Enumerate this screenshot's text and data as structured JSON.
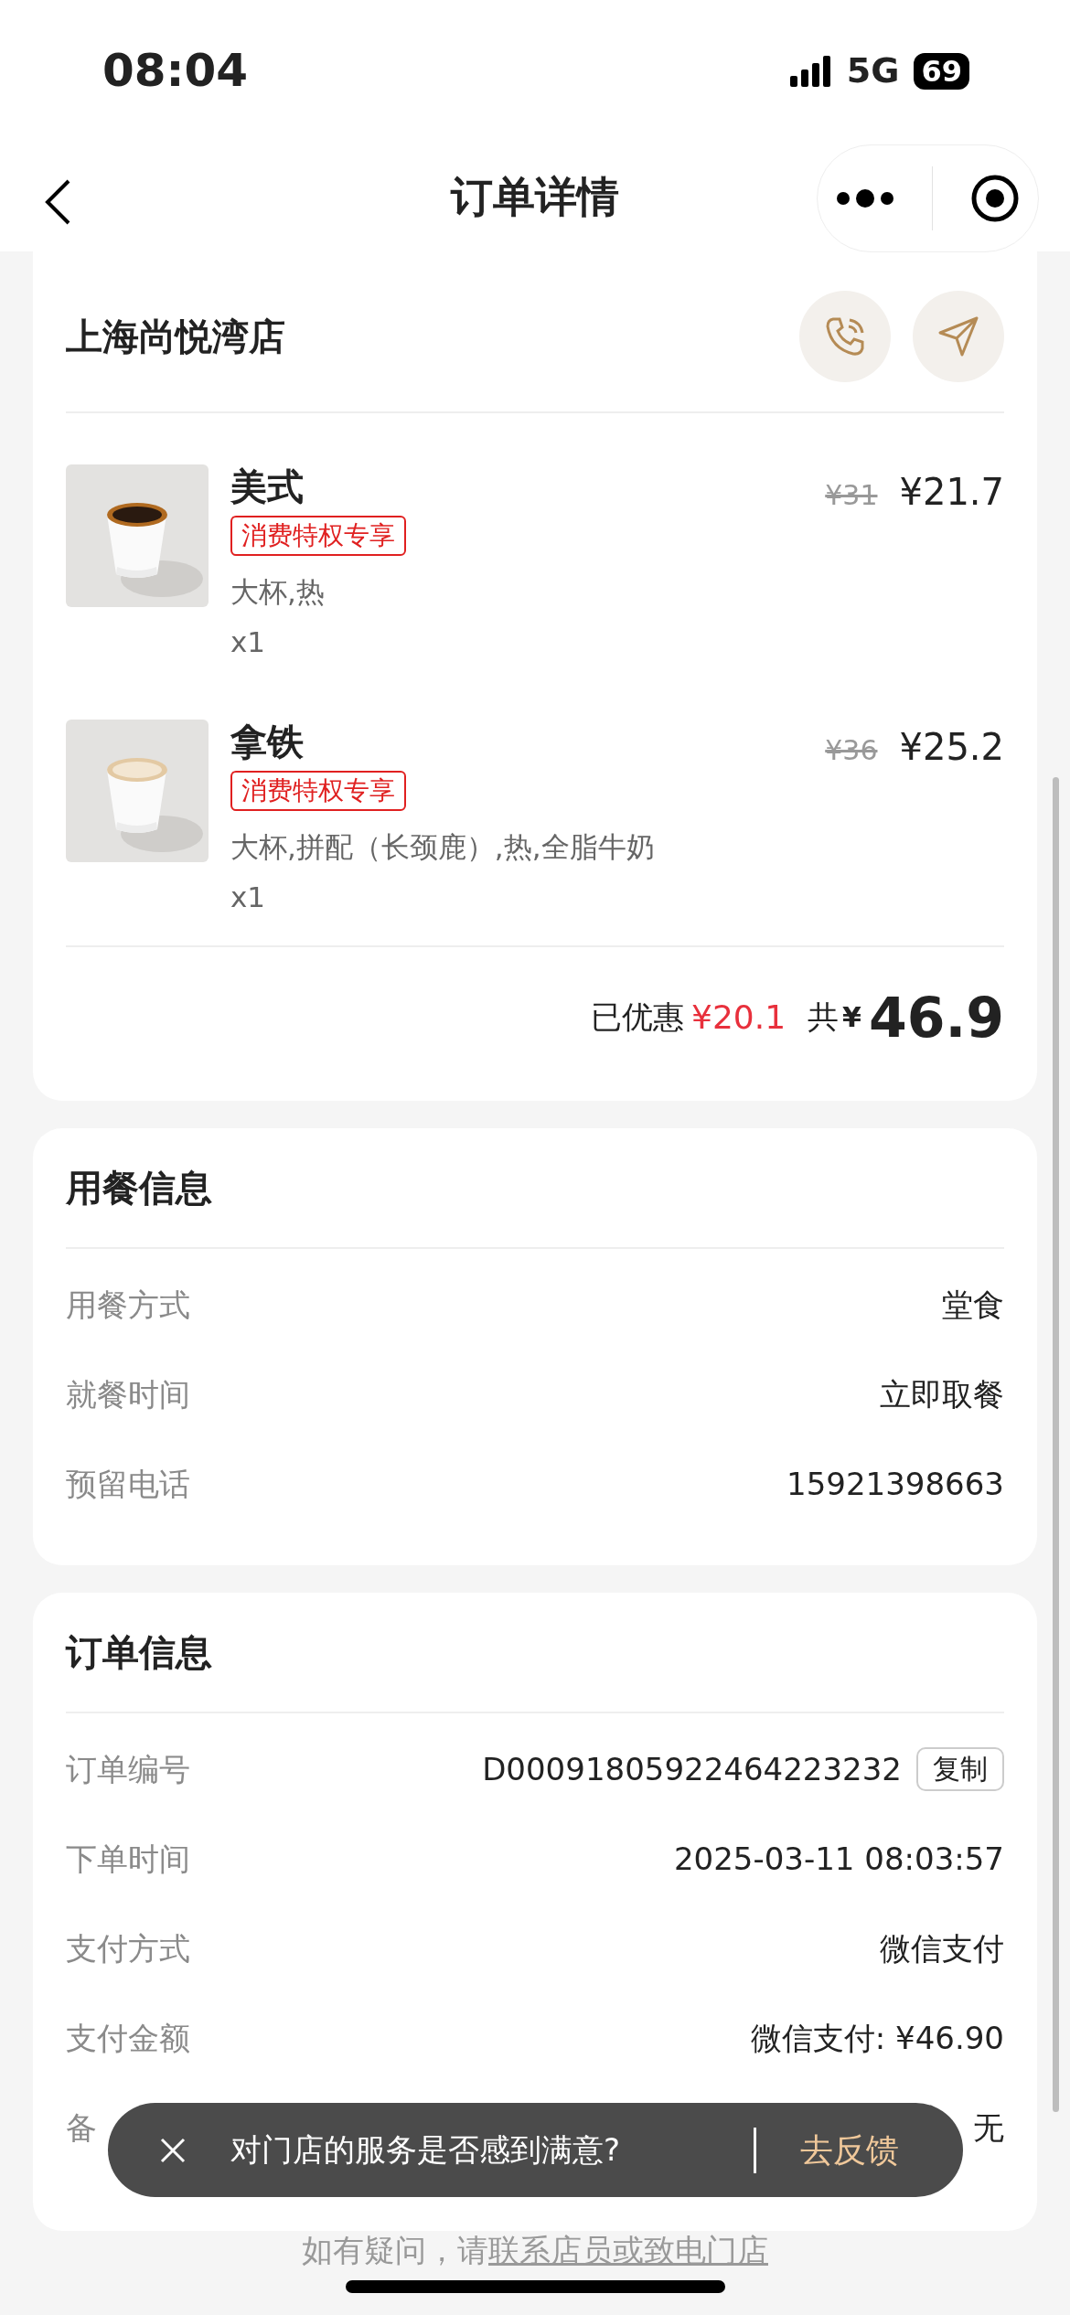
{
  "status_bar": {
    "time": "08:04",
    "network": "5G",
    "battery": "69"
  },
  "nav": {
    "title": "订单详情"
  },
  "store": {
    "name": "上海尚悦湾店"
  },
  "items": [
    {
      "name": "美式",
      "tag": "消费特权专享",
      "spec": "大杯,热",
      "qty": "x1",
      "original_price": "¥31",
      "price": "¥21.7",
      "kind": "black"
    },
    {
      "name": "拿铁",
      "tag": "消费特权专享",
      "spec": "大杯,拼配（长颈鹿）,热,全脂牛奶",
      "qty": "x1",
      "original_price": "¥36",
      "price": "¥25.2",
      "kind": "latte"
    }
  ],
  "summary": {
    "discount_label": "已优惠",
    "discount": "¥20.1",
    "total_label": "共",
    "currency": "¥",
    "total": "46.9"
  },
  "dining": {
    "title": "用餐信息",
    "rows": [
      {
        "label": "用餐方式",
        "value": "堂食"
      },
      {
        "label": "就餐时间",
        "value": "立即取餐"
      },
      {
        "label": "预留电话",
        "value": "15921398663"
      }
    ]
  },
  "order": {
    "title": "订单信息",
    "rows": [
      {
        "label": "订单编号",
        "value": "D00091805922464223232",
        "action": "复制"
      },
      {
        "label": "下单时间",
        "value": "2025-03-11 08:03:57"
      },
      {
        "label": "支付方式",
        "value": "微信支付"
      },
      {
        "label": "支付金额",
        "value": "微信支付: ¥46.90"
      },
      {
        "label": "备",
        "value": "无"
      }
    ]
  },
  "toast": {
    "text": "对门店的服务是否感到满意?",
    "action": "去反馈"
  },
  "footer": {
    "text": "如有疑问，请",
    "link": "联系店员或致电门店"
  }
}
